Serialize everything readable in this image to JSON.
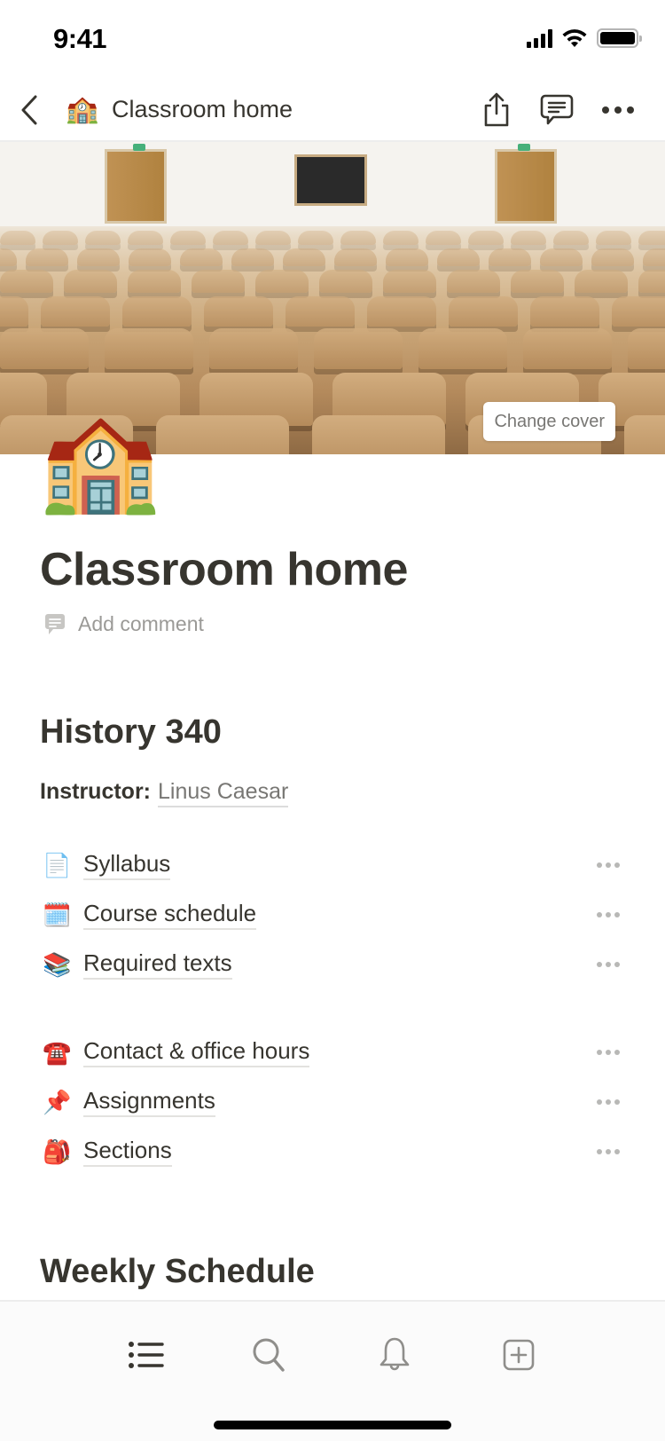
{
  "status_bar": {
    "time": "9:41",
    "icons": [
      "cellular-signal-icon",
      "wifi-icon",
      "battery-icon"
    ]
  },
  "nav": {
    "back_icon": "chevron-left-icon",
    "page_emoji": "🏫",
    "title": "Classroom home",
    "actions": [
      "share-icon",
      "comment-icon",
      "more-icon"
    ]
  },
  "cover": {
    "change_cover_label": "Change cover"
  },
  "page": {
    "icon": "🏫",
    "title": "Classroom home",
    "add_comment_label": "Add comment"
  },
  "section_history": {
    "heading": "History 340",
    "instructor_label": "Instructor:",
    "instructor_name": "Linus Caesar",
    "links_group_1": [
      {
        "emoji": "📄",
        "label": "Syllabus"
      },
      {
        "emoji": "🗓️",
        "label": "Course schedule"
      },
      {
        "emoji": "📚",
        "label": "Required texts"
      }
    ],
    "links_group_2": [
      {
        "emoji": "☎️",
        "label": "Contact & office hours"
      },
      {
        "emoji": "📌",
        "label": "Assignments"
      },
      {
        "emoji": "🎒",
        "label": "Sections"
      }
    ]
  },
  "section_weekly": {
    "heading": "Weekly Schedule"
  },
  "tab_bar": {
    "tabs": [
      {
        "name": "pages",
        "icon": "list-icon",
        "active": true
      },
      {
        "name": "search",
        "icon": "search-icon",
        "active": false
      },
      {
        "name": "notifications",
        "icon": "bell-icon",
        "active": false
      },
      {
        "name": "new-page",
        "icon": "plus-square-icon",
        "active": false
      }
    ]
  }
}
